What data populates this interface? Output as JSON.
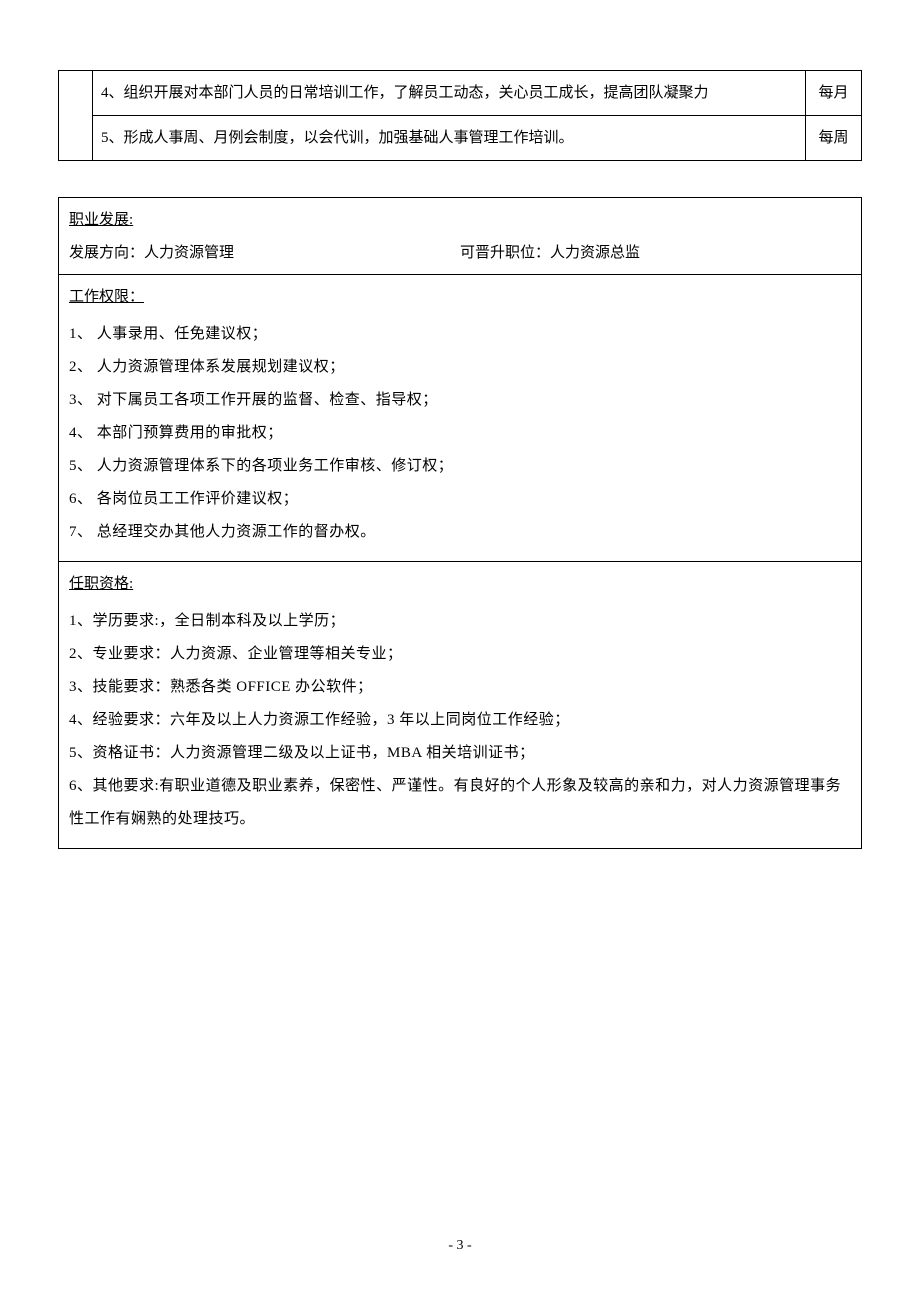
{
  "topTable": {
    "rows": [
      {
        "text": "4、组织开展对本部门人员的日常培训工作，了解员工动态，关心员工成长，提高团队凝聚力",
        "freq": "每月"
      },
      {
        "text": "5、形成人事周、月例会制度，以会代训，加强基础人事管理工作培训。",
        "freq": "每周"
      }
    ]
  },
  "career": {
    "title": "职业发展:",
    "directionLabel": "发展方向：人力资源管理",
    "promoteLabel": "可晋升职位：人力资源总监"
  },
  "authority": {
    "title": "工作权限：",
    "items": [
      "1、 人事录用、任免建议权；",
      "2、 人力资源管理体系发展规划建议权；",
      "3、 对下属员工各项工作开展的监督、检查、指导权；",
      "4、 本部门预算费用的审批权；",
      "5、 人力资源管理体系下的各项业务工作审核、修订权；",
      "6、 各岗位员工工作评价建议权；",
      "7、 总经理交办其他人力资源工作的督办权。"
    ]
  },
  "qualification": {
    "title": "任职资格:",
    "items": [
      "1、学历要求:，全日制本科及以上学历；",
      "2、专业要求：人力资源、企业管理等相关专业；",
      "3、技能要求：熟悉各类 OFFICE 办公软件；",
      "4、经验要求：六年及以上人力资源工作经验，3 年以上同岗位工作经验；",
      "5、资格证书：人力资源管理二级及以上证书，MBA 相关培训证书；",
      "6、其他要求:有职业道德及职业素养，保密性、严谨性。有良好的个人形象及较高的亲和力，对人力资源管理事务性工作有娴熟的处理技巧。"
    ]
  },
  "pageNumber": "- 3 -"
}
